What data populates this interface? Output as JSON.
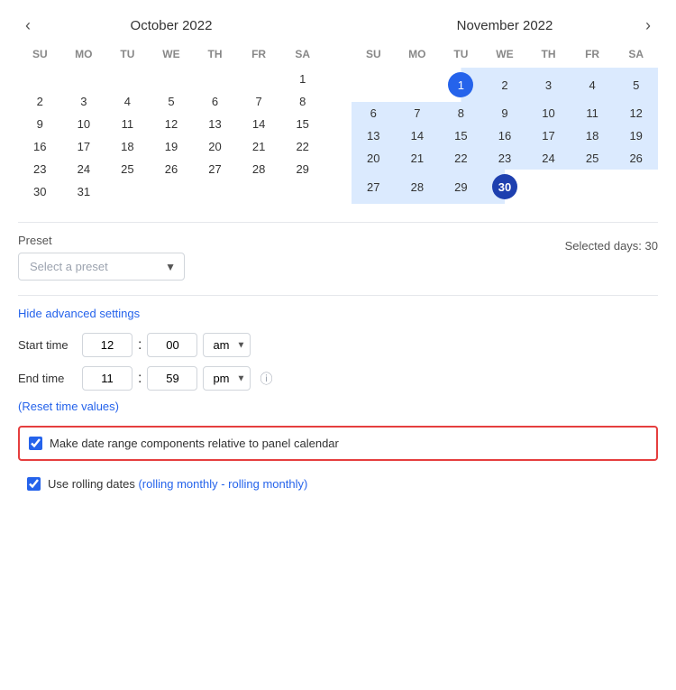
{
  "calendars": [
    {
      "id": "october",
      "monthYear": "October  2022",
      "showLeftNav": true,
      "showRightNav": false,
      "days": [
        "SU",
        "MO",
        "TU",
        "WE",
        "TH",
        "FR",
        "SA"
      ],
      "weeks": [
        [
          null,
          null,
          null,
          null,
          null,
          null,
          "1"
        ],
        [
          "2",
          "3",
          "4",
          "5",
          "6",
          "7",
          "8"
        ],
        [
          "9",
          "10",
          "11",
          "12",
          "13",
          "14",
          "15"
        ],
        [
          "16",
          "17",
          "18",
          "19",
          "20",
          "21",
          "22"
        ],
        [
          "23",
          "24",
          "25",
          "26",
          "27",
          "28",
          "29"
        ],
        [
          "30",
          "31",
          null,
          null,
          null,
          null,
          null
        ]
      ]
    },
    {
      "id": "november",
      "monthYear": "November  2022",
      "showLeftNav": false,
      "showRightNav": true,
      "days": [
        "SU",
        "MO",
        "TU",
        "WE",
        "TH",
        "FR",
        "SA"
      ],
      "weeks": [
        [
          null,
          null,
          "1",
          "2",
          "3",
          "4",
          "5"
        ],
        [
          "6",
          "7",
          "8",
          "9",
          "10",
          "11",
          "12"
        ],
        [
          "13",
          "14",
          "15",
          "16",
          "17",
          "18",
          "19"
        ],
        [
          "20",
          "21",
          "22",
          "23",
          "24",
          "25",
          "26"
        ],
        [
          "27",
          "28",
          "29",
          "30",
          null,
          null,
          null
        ]
      ]
    }
  ],
  "november_start_day": "1",
  "november_end_day": "30",
  "preset": {
    "label": "Preset",
    "placeholder": "Select a preset",
    "selected_days_label": "Selected days: 30"
  },
  "advanced": {
    "toggle_label": "Hide advanced settings"
  },
  "time": {
    "start_label": "Start time",
    "start_hour": "12",
    "start_minute": "00",
    "start_ampm": "am",
    "end_label": "End time",
    "end_hour": "11",
    "end_minute": "59",
    "end_ampm": "pm",
    "ampm_options": [
      "am",
      "pm"
    ],
    "reset_label": "(Reset time values)"
  },
  "checkboxes": [
    {
      "id": "relative",
      "label": "Make date range components relative to panel calendar",
      "checked": true,
      "highlighted": true,
      "rolling_link": null
    },
    {
      "id": "rolling",
      "label": "Use rolling dates ",
      "checked": true,
      "highlighted": false,
      "rolling_link": "(rolling monthly - rolling monthly)"
    }
  ]
}
